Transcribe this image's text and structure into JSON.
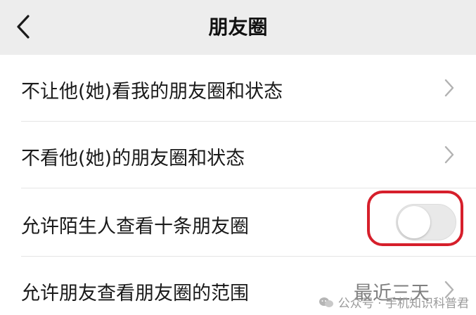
{
  "header": {
    "title": "朋友圈",
    "back_icon": "chevron-left-icon"
  },
  "settings": [
    {
      "label": "不让他(她)看我的朋友圈和状态",
      "control": "chevron-right-icon"
    },
    {
      "label": "不看他(她)的朋友圈和状态",
      "control": "chevron-right-icon"
    },
    {
      "label": "允许陌生人查看十条朋友圈",
      "control": "toggle",
      "toggle_on": false
    },
    {
      "label": "允许朋友查看朋友圈的范围",
      "value": "最近三天",
      "control": "chevron-right-icon"
    }
  ],
  "watermark": {
    "text": "公众号 · 手机知识科普君",
    "icon": "wechat-official-account-icon"
  },
  "colors": {
    "nav_background": "#ededed",
    "highlight_border": "#d61f2b",
    "toggle_off": "#e9e9e9",
    "value_text": "#7f7f7f"
  }
}
